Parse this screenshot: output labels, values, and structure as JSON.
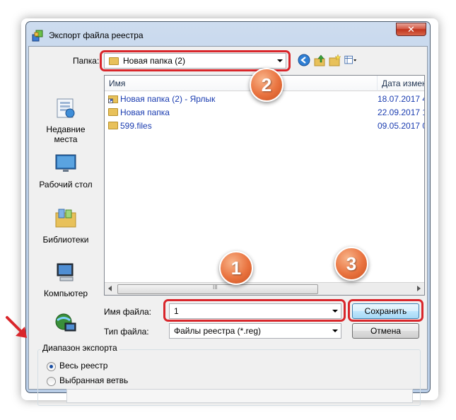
{
  "dialog": {
    "title": "Экспорт файла реестра",
    "close_symbol": "✕"
  },
  "folder_bar": {
    "label": "Папка:",
    "current": "Новая папка (2)"
  },
  "places": [
    {
      "label_line1": "Недавние",
      "label_line2": "места",
      "icon": "recent-places-icon"
    },
    {
      "label_line1": "Рабочий стол",
      "label_line2": "",
      "icon": "desktop-icon"
    },
    {
      "label_line1": "Библиотеки",
      "label_line2": "",
      "icon": "libraries-icon"
    },
    {
      "label_line1": "Компьютер",
      "label_line2": "",
      "icon": "computer-icon"
    },
    {
      "label_line1": "",
      "label_line2": "",
      "icon": "network-icon"
    }
  ],
  "file_list": {
    "columns": [
      "Имя",
      "Дата измен"
    ],
    "rows": [
      {
        "name": "Новая папка (2) - Ярлык",
        "date": "18.07.2017 4",
        "icon": "shortcut-icon"
      },
      {
        "name": "Новая папка",
        "date": "22.09.2017 1",
        "icon": "folder-icon"
      },
      {
        "name": "599.files",
        "date": "09.05.2017 0",
        "icon": "folder-icon"
      }
    ],
    "scroll_mark": "III"
  },
  "filename": {
    "label": "Имя файла:",
    "value": "1"
  },
  "filetype": {
    "label": "Тип файла:",
    "value": "Файлы реестра (*.reg)"
  },
  "buttons": {
    "save": "Сохранить",
    "cancel": "Отмена"
  },
  "export_range": {
    "title": "Диапазон экспорта",
    "options": [
      {
        "label": "Весь реестр",
        "selected": true
      },
      {
        "label": "Выбранная ветвь",
        "selected": false
      }
    ],
    "branch_value": ""
  },
  "annotations": {
    "step1": "1",
    "step2": "2",
    "step3": "3",
    "color": "#d9262b"
  }
}
